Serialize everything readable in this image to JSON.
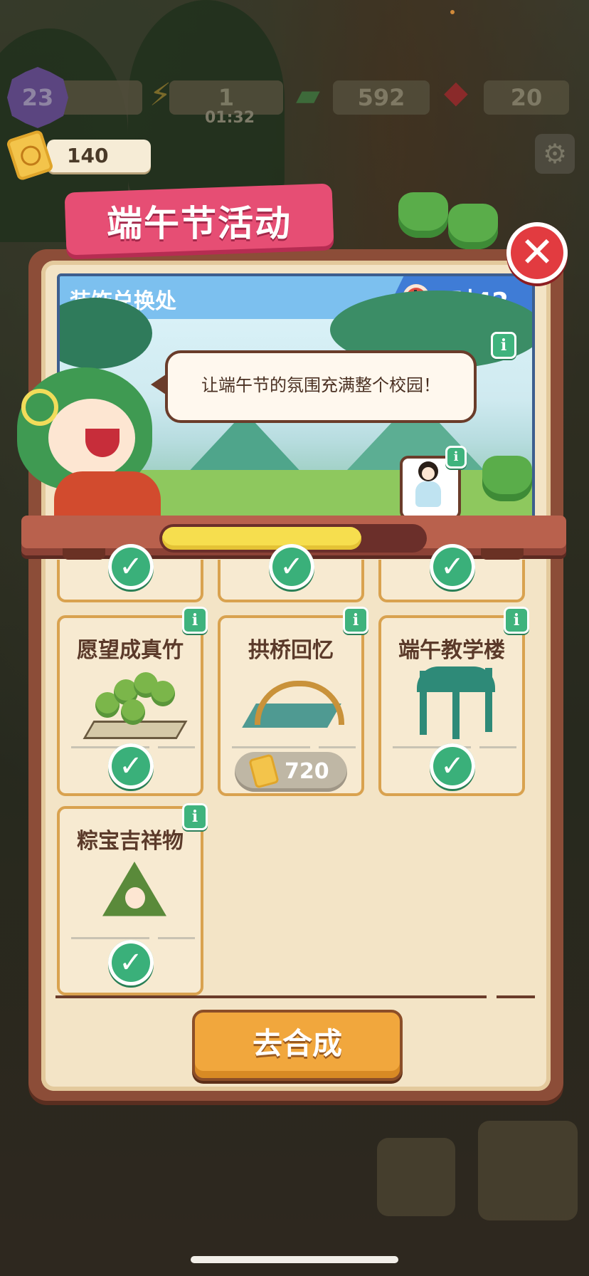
{
  "hud": {
    "level": "23",
    "energy": "1",
    "energy_timer": "01:32",
    "cash": "592",
    "gems": "20",
    "tickets": "140"
  },
  "event": {
    "title": "端午节活动",
    "shop_title": "装饰兑换处",
    "time_left": "4时42分",
    "speech": "让端午节的氛围充满整个校园！",
    "progress": 0.76,
    "info_label": "i"
  },
  "items": [
    {
      "name": "愿望成真竹",
      "status": "owned"
    },
    {
      "name": "拱桥回忆",
      "status": "locked",
      "price": "720"
    },
    {
      "name": "端午教学楼",
      "status": "owned"
    },
    {
      "name": "粽宝吉祥物",
      "status": "owned"
    }
  ],
  "check_symbol": "✓",
  "actions": {
    "go_synthesize": "去合成",
    "close": "✕"
  },
  "colors": {
    "ribbon": "#e64e74",
    "panel": "#8c4d38",
    "progress": "#f6de4e",
    "check": "#3ab07a",
    "button": "#f1a73d"
  }
}
